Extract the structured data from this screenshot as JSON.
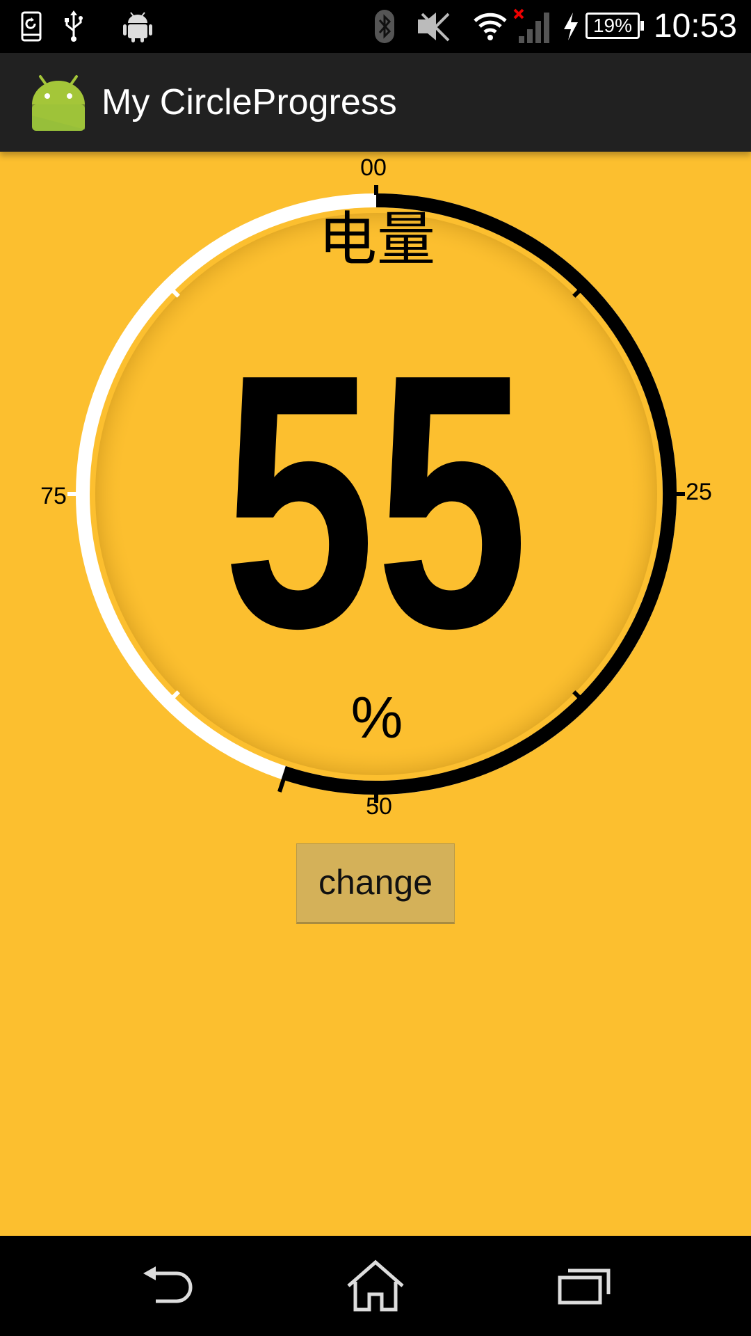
{
  "status_bar": {
    "time": "10:53",
    "battery_percent": "19%",
    "icons": [
      "screen-rotate-icon",
      "usb-icon",
      "android-debug-icon",
      "bluetooth-icon",
      "nfc-off-icon",
      "wifi-icon",
      "signal-no-sim-icon",
      "charging-icon",
      "battery-icon"
    ]
  },
  "action_bar": {
    "title": "My CircleProgress",
    "logo": "android-logo-icon"
  },
  "gauge": {
    "label": "电量",
    "value": "55",
    "unit": "%",
    "progress": 55,
    "max": 100,
    "ticks": {
      "top": "00",
      "right": "25",
      "bottom": "50",
      "left": "75"
    },
    "colors": {
      "background": "#FCBF2F",
      "progress": "#000000",
      "remaining": "#FFFFFF",
      "text": "#000000"
    }
  },
  "button": {
    "label": "change"
  },
  "nav_bar": {
    "icons": [
      "back-icon",
      "home-icon",
      "recent-apps-icon"
    ]
  }
}
